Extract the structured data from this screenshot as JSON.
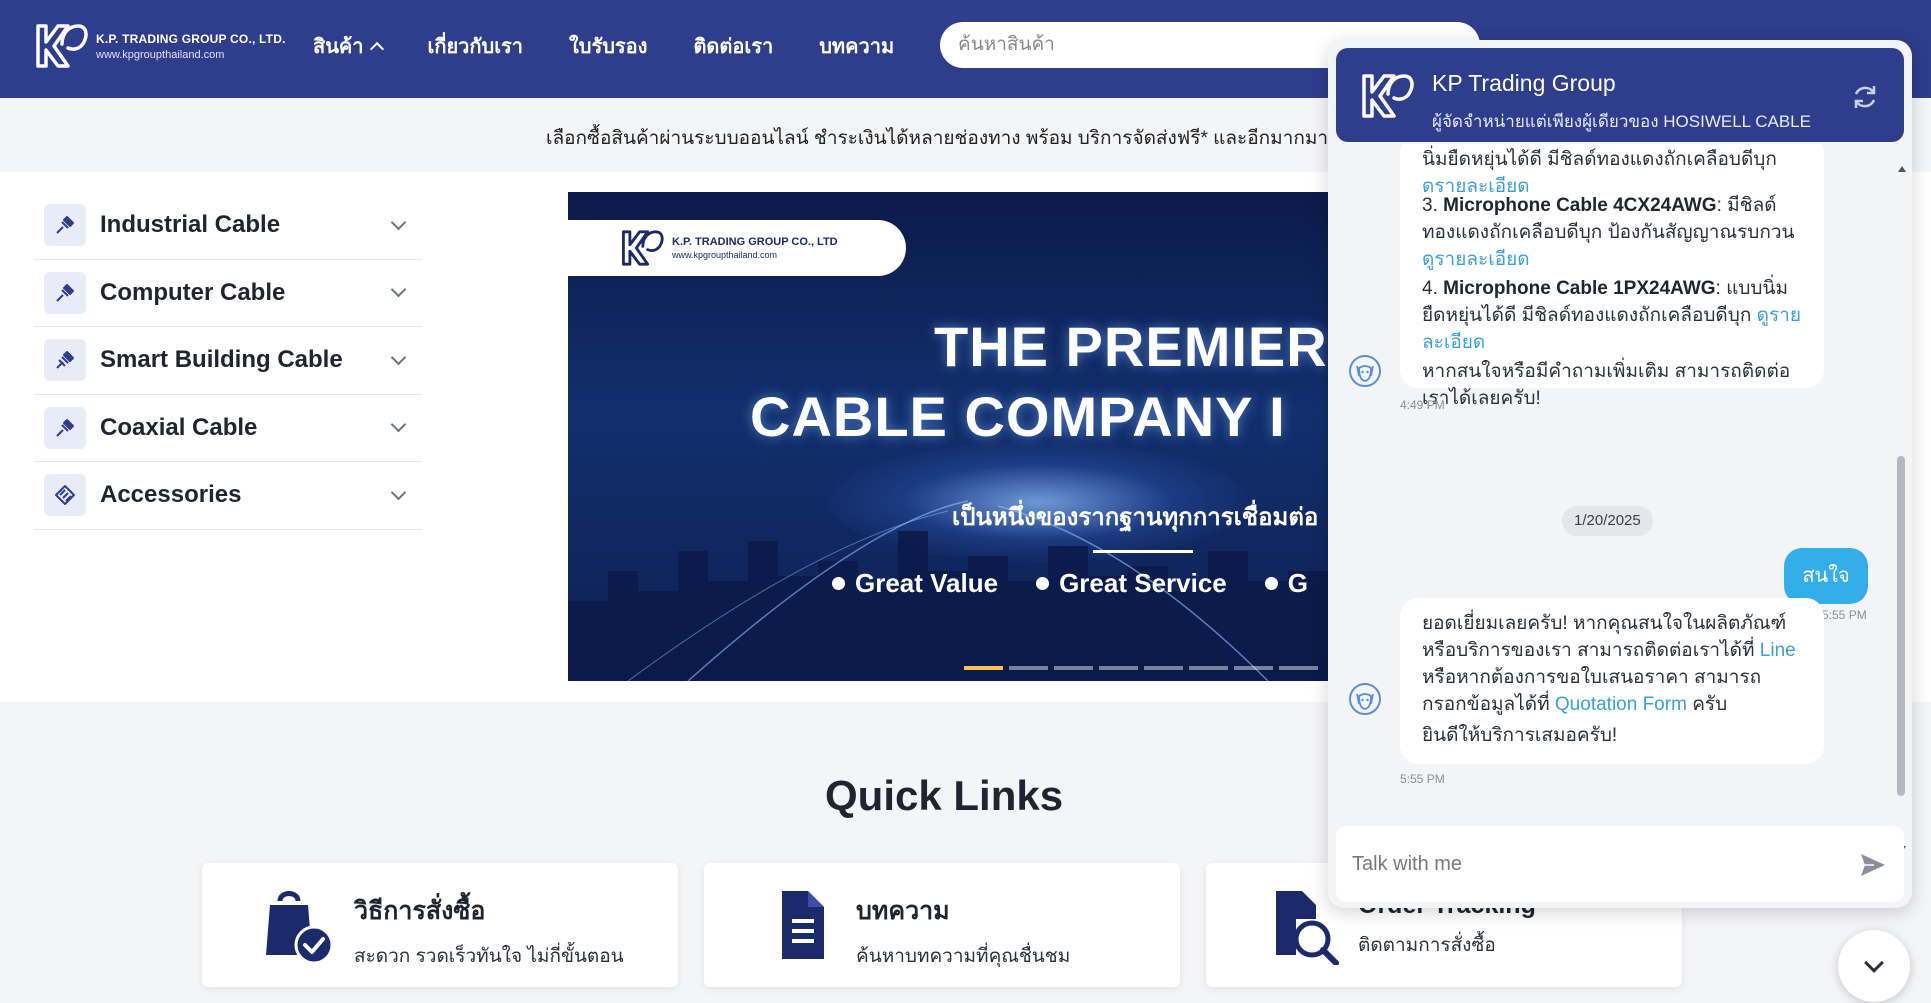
{
  "header": {
    "logo_company": "K.P. TRADING GROUP CO., LTD.",
    "logo_url": "www.kpgroupthailand.com",
    "nav": [
      {
        "label": "สินค้า"
      },
      {
        "label": "เกี่ยวกับเรา"
      },
      {
        "label": "ใบรับรอง"
      },
      {
        "label": "ติดต่อเรา"
      },
      {
        "label": "บทความ"
      }
    ],
    "search_placeholder": "ค้นหาสินค้า",
    "brand_color": "#2e3d8c"
  },
  "promo": {
    "text": "เลือกซื้อสินค้าผ่านระบบออนไลน์ ชำระเงินได้หลายช่องทาง พร้อม บริการจัดส่งฟรี* และอีกมากมาย"
  },
  "categories": [
    {
      "label": "Industrial Cable",
      "icon": "cable-icon"
    },
    {
      "label": "Computer Cable",
      "icon": "cable-icon"
    },
    {
      "label": "Smart Building Cable",
      "icon": "cable-icon"
    },
    {
      "label": "Coaxial Cable",
      "icon": "cable-icon"
    },
    {
      "label": "Accessories",
      "icon": "connector-icon"
    }
  ],
  "hero": {
    "pill_company": "K.P. TRADING GROUP CO., LTD",
    "pill_url": "www.kpgroupthailand.com",
    "title_line1": "THE PREMIER",
    "title_line2": "CABLE COMPANY I",
    "subtitle": "เป็นหนึ่งของรากฐานทุกการเชื่อมต่อ",
    "bullets": [
      "Great Value",
      "Great Service",
      "G"
    ],
    "active_slide": 1,
    "slide_count": 8,
    "active_dot_color": "#f5c451"
  },
  "quick_links": {
    "title": "Quick Links",
    "cards": [
      {
        "title": "วิธีการสั่งซื้อ",
        "desc": "สะดวก รวดเร็วทันใจ ไม่กี่ขั้นตอน",
        "icon": "shopping-bag-icon"
      },
      {
        "title": "บทความ",
        "desc": "ค้นหาบทความที่คุณชื่นชม",
        "icon": "document-icon"
      },
      {
        "title": "Order Tracking",
        "desc": "ติดตามการสั่งซื้อ",
        "icon": "tracking-icon"
      }
    ]
  },
  "chat": {
    "name": "KP Trading Group",
    "tagline": "ผู้จัดจำหน่ายแต่เพียงผู้เดียวของ HOSIWELL CABLE",
    "msg1": {
      "top_line": "นิ่มยืดหยุ่นได้ดี มีชิลด์ทองแดงถักเคลือบดีบุก",
      "top_link": "ดูรายละเอียด",
      "item3_num": "3.",
      "item3_name": "Microphone Cable 4CX24AWG",
      "item3_desc": ": มีชิลด์ทองแดงถักเคลือบดีบุก ป้องกันสัญญาณรบกวน",
      "item3_link": "ดูรายละเอียด",
      "item4_num": "4.",
      "item4_name": "Microphone Cable 1PX24AWG",
      "item4_desc": ": แบบนิ่มยืดหยุ่นได้ดี มีชิลด์ทองแดงถักเคลือบดีบุก",
      "item4_link": "ดูรายละเอียด",
      "closing": "หากสนใจหรือมีคำถามเพิ่มเติม สามารถติดต่อเราได้เลยครับ!",
      "time": "4:49 PM"
    },
    "date_divider": "1/20/2025",
    "user_msg": {
      "text": "สนใจ",
      "time": "5:55 PM"
    },
    "msg2": {
      "part1": "ยอดเยี่ยมเลยครับ! หากคุณสนใจในผลิตภัณฑ์หรือบริการของเรา สามารถติดต่อเราได้ที่",
      "link_line": "Line",
      "part2": "หรือหากต้องการขอใบเสนอราคา สามารถกรอกข้อมูลได้ที่",
      "link_form": "Quotation Form",
      "part3": "ครับ",
      "closing": "ยินดีให้บริการเสมอครับ!",
      "time": "5:55 PM"
    },
    "input_placeholder": "Talk with me",
    "user_bubble_color": "#33aee8",
    "link_color": "#3aa0d8"
  }
}
